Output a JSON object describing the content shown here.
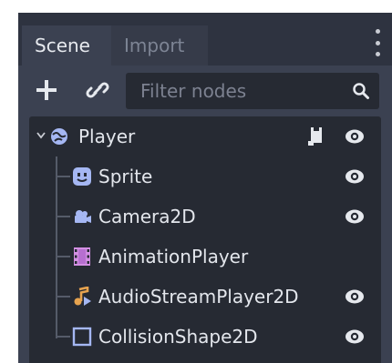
{
  "tabs": {
    "scene": "Scene",
    "import": "Import"
  },
  "filter": {
    "placeholder": "Filter nodes"
  },
  "colors": {
    "panel_bg": "#3b4151",
    "tree_bg": "#262a33",
    "node2d_blue": "#a5b7f3",
    "animation_purple": "#d38fe3",
    "audio_orange": "#e7a34f"
  },
  "tree": {
    "root": {
      "label": "Player",
      "icon": "node2d-globe-icon"
    },
    "children": [
      {
        "label": "Sprite",
        "icon": "sprite-icon"
      },
      {
        "label": "Camera2D",
        "icon": "camera2d-icon"
      },
      {
        "label": "AnimationPlayer",
        "icon": "animation-player-icon"
      },
      {
        "label": "AudioStreamPlayer2D",
        "icon": "audio-stream-player-icon"
      },
      {
        "label": "CollisionShape2D",
        "icon": "collision-shape-icon"
      }
    ]
  }
}
